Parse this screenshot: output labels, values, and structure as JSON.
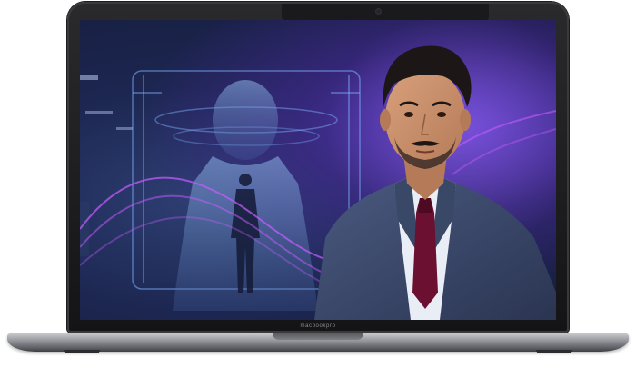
{
  "device": {
    "brand_label": "macbookpro",
    "screen_content": "promotional-photo"
  },
  "colors": {
    "bezel": "#1a1a1c",
    "screen_purple": "#5b3bbd",
    "screen_blue": "#1c2650",
    "hologram_cyan": "#8fc6ff",
    "wave_magenta": "#c85cff",
    "suit": "#3a4868",
    "tie": "#6b1030",
    "shirt": "#e9edf5"
  }
}
